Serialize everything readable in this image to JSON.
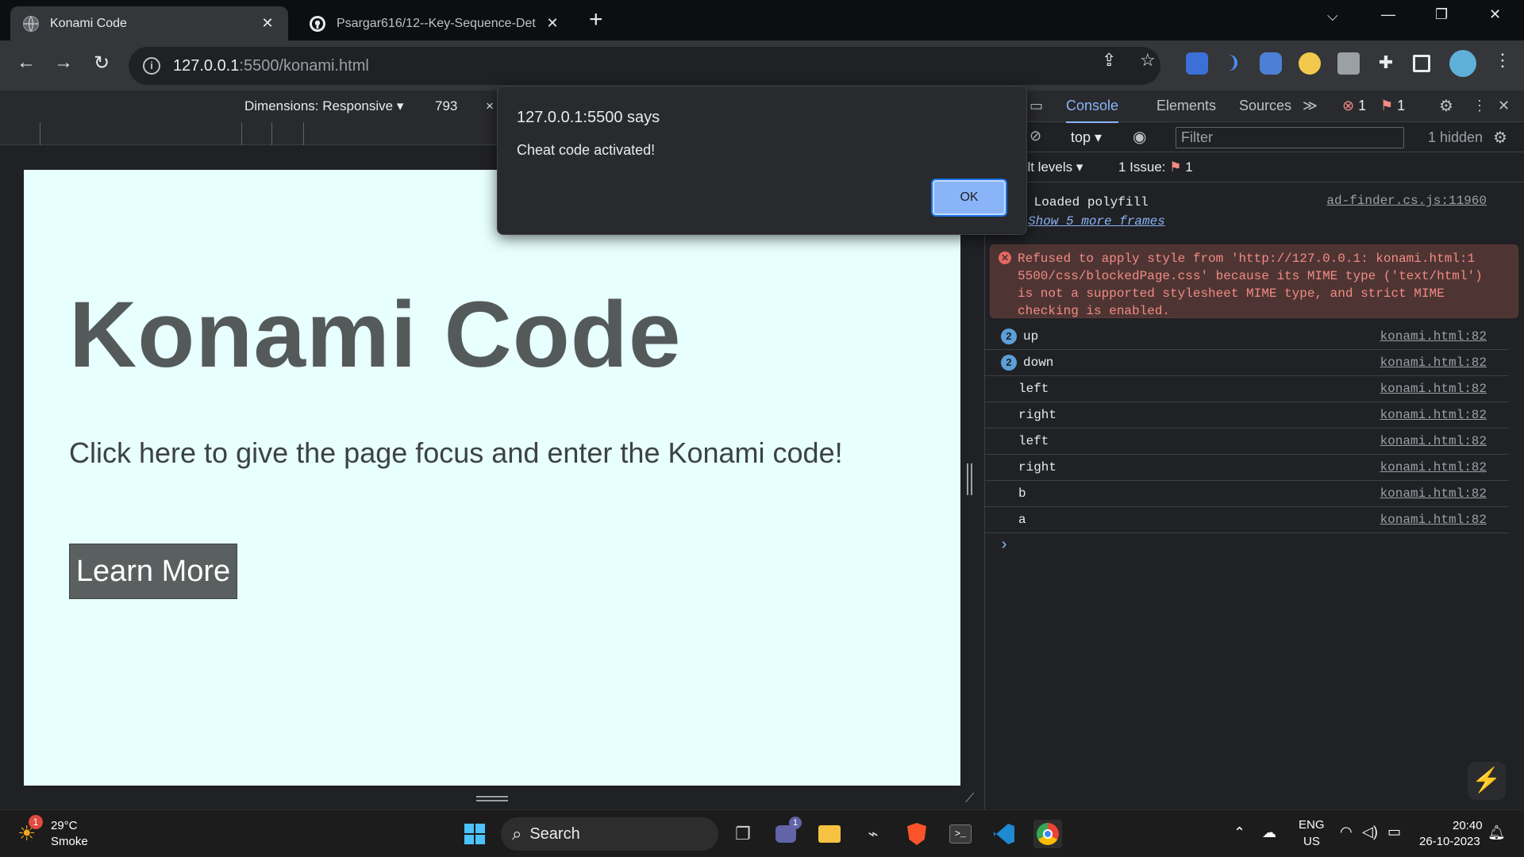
{
  "browser": {
    "tabs": [
      {
        "title": "Konami Code",
        "active": true
      },
      {
        "title": "Psargar616/12--Key-Sequence-Det",
        "active": false
      }
    ],
    "new_tab": "+",
    "window_controls": {
      "collapse": "⌵",
      "minimize": "—",
      "restore": "❐",
      "close": "✕"
    },
    "url_host": "127.0.0.1",
    "url_path": ":5500/konami.html"
  },
  "device_toolbar": {
    "dimensions_label": "Dimensions: Responsive",
    "width": "793",
    "x": "×"
  },
  "page": {
    "heading": "Konami Code",
    "instructions": "Click here to give the page focus and enter the Konami code!",
    "button_label": "Learn More",
    "background": "#e8ffff"
  },
  "alert": {
    "title": "127.0.0.1:5500 says",
    "message": "Cheat code activated!",
    "ok_label": "OK"
  },
  "devtools": {
    "tabs": [
      "Console",
      "Elements",
      "Sources"
    ],
    "more": "≫",
    "error_count": "1",
    "issue_count": "1",
    "context": "top",
    "filter_placeholder": "Filter",
    "hidden": "1 hidden",
    "levels": "ult levels",
    "issues_label": "1 Issue:",
    "issues_value": "1",
    "log": {
      "polyfill": "Loaded polyfill",
      "polyfill_src": "ad-finder.cs.js:11960",
      "more_frames": "Show 5 more frames",
      "error_lines": [
        "Refused to apply style from 'http://127.0.0.1: konami.html:1",
        "5500/css/blockedPage.css' because its MIME type ('text/html')",
        "is not a supported stylesheet MIME type, and strict MIME",
        "checking is enabled."
      ],
      "entries": [
        {
          "badge": "2",
          "text": "up",
          "src": "konami.html:82"
        },
        {
          "badge": "2",
          "text": "down",
          "src": "konami.html:82"
        },
        {
          "badge": "",
          "text": "left",
          "src": "konami.html:82"
        },
        {
          "badge": "",
          "text": "right",
          "src": "konami.html:82"
        },
        {
          "badge": "",
          "text": "left",
          "src": "konami.html:82"
        },
        {
          "badge": "",
          "text": "right",
          "src": "konami.html:82"
        },
        {
          "badge": "",
          "text": "b",
          "src": "konami.html:82"
        },
        {
          "badge": "",
          "text": "a",
          "src": "konami.html:82"
        }
      ],
      "prompt": "›"
    }
  },
  "taskbar": {
    "weather_temp": "29°C",
    "weather_desc": "Smoke",
    "weather_badge": "1",
    "search_label": "Search",
    "meet_badge": "1",
    "lang": "ENG",
    "region": "US",
    "time": "20:40",
    "date": "26-10-2023"
  }
}
